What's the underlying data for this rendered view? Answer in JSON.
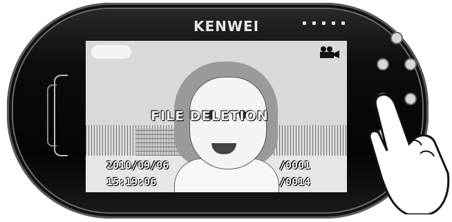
{
  "device": {
    "brand": "KENWEI"
  },
  "screen": {
    "title": "FILE DELETION",
    "date": "2010/09/06",
    "time": "15:19:06",
    "current_index": "/0001",
    "total_count": "/0014"
  },
  "icons": {
    "camera": "video-camera-icon",
    "status": [
      "lock-icon",
      "bell-icon",
      "battery-icon",
      "mail-icon",
      "alert-icon"
    ],
    "buttons": [
      "menu-button",
      "up-button",
      "down-button",
      "left-button",
      "right-button",
      "ok-button"
    ]
  },
  "colors": {
    "bezel": "#0b0b0b",
    "screen_bg": "#d9d9d9",
    "osd_text": "#f5f5f5"
  }
}
